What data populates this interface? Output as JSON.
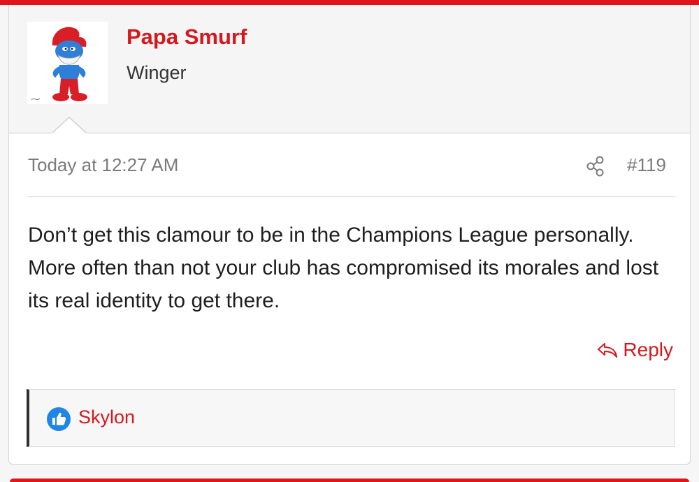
{
  "post": {
    "author": {
      "name": "Papa Smurf",
      "title": "Winger",
      "avatar": "papa-smurf-avatar"
    },
    "meta": {
      "timestamp": "Today at 12:27 AM",
      "post_number": "#119",
      "share_icon": "share-icon"
    },
    "body": "Don’t get this clamour to be in the Champions League personally. More often than not your club has compromised its morales and lost its real identity to get there.",
    "actions": {
      "reply_label": "Reply",
      "reply_icon": "reply-icon"
    },
    "reactions": {
      "icon": "thumbs-up-icon",
      "users": [
        "Skylon"
      ]
    }
  },
  "colors": {
    "brand_red": "#e0141b",
    "link_red": "#d6181e",
    "meta_grey": "#7b7b7b",
    "like_blue": "#1f86e5"
  }
}
